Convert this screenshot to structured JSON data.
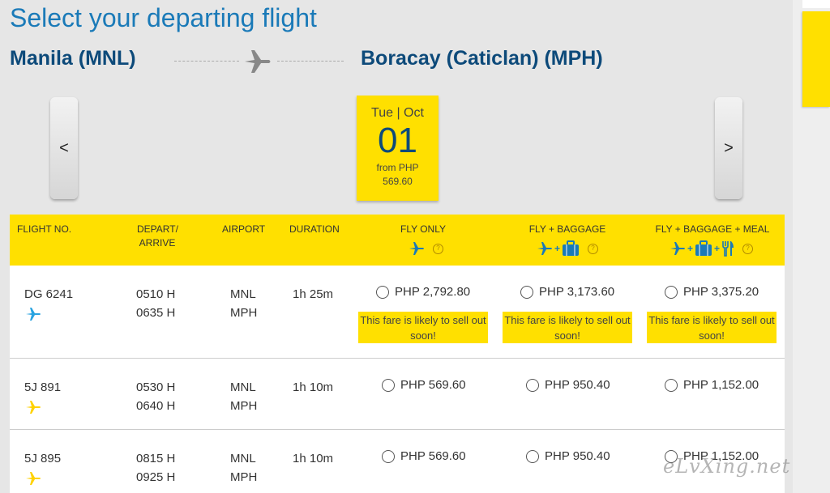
{
  "page": {
    "title": "Select your departing flight"
  },
  "route": {
    "origin": "Manila (MNL)",
    "destination": "Boracay (Caticlan) (MPH)"
  },
  "date_nav": {
    "prev_label": "<",
    "next_label": ">"
  },
  "selected_date": {
    "dow_month": "Tue | Oct",
    "day": "01",
    "from_label": "from PHP",
    "price": "569.60"
  },
  "table": {
    "headers": {
      "flight_no": "FLIGHT NO.",
      "depart_line1": "DEPART/",
      "depart_line2": "ARRIVE",
      "airport": "AIRPORT",
      "duration": "DURATION",
      "fly_only": "FLY ONLY",
      "fly_baggage": "FLY + BAGGAGE",
      "fly_baggage_meal": "FLY + BAGGAGE + MEAL",
      "help_symbol": "?"
    },
    "rows": [
      {
        "flight": "DG 6241",
        "airline_color": "#29a3e0",
        "depart": "0510 H",
        "arrive": "0635 H",
        "from_airport": "MNL",
        "to_airport": "MPH",
        "duration": "1h 25m",
        "fly_only": "PHP 2,792.80",
        "fly_baggage": "PHP 3,173.60",
        "fly_baggage_meal": "PHP 3,375.20",
        "sellout_note": "This fare is likely to sell out soon!"
      },
      {
        "flight": "5J 891",
        "airline_color": "#ffd200",
        "depart": "0530 H",
        "arrive": "0640 H",
        "from_airport": "MNL",
        "to_airport": "MPH",
        "duration": "1h 10m",
        "fly_only": "PHP 569.60",
        "fly_baggage": "PHP 950.40",
        "fly_baggage_meal": "PHP 1,152.00"
      },
      {
        "flight": "5J 895",
        "airline_color": "#ffd200",
        "depart": "0815 H",
        "arrive": "0925 H",
        "from_airport": "MNL",
        "to_airport": "MPH",
        "duration": "1h 10m",
        "fly_only": "PHP 569.60",
        "fly_baggage": "PHP 950.40",
        "fly_baggage_meal": "PHP 1,152.00"
      }
    ]
  },
  "watermark": "eLvXing.net",
  "colors": {
    "accent_yellow": "#ffe000",
    "title_blue": "#1a7ab8",
    "navy": "#0d4a7a",
    "icon_blue": "#1a7ab8"
  }
}
